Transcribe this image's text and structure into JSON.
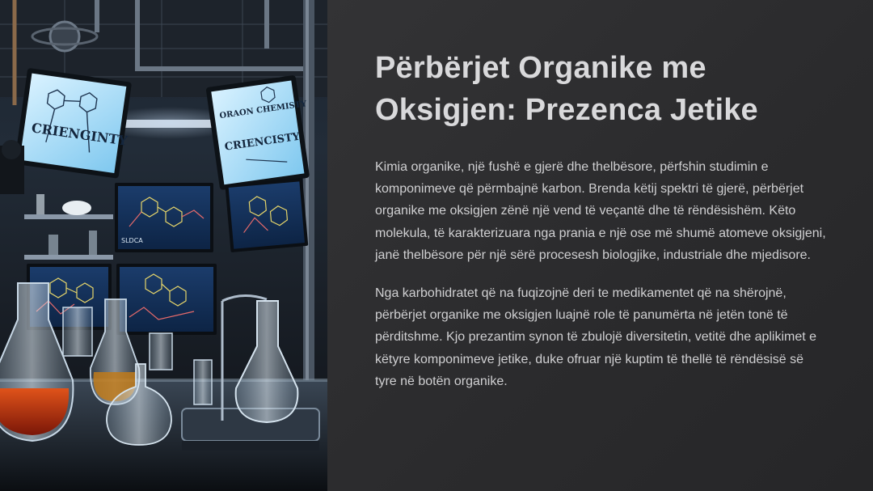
{
  "slide": {
    "title": "Përbërjet Organike me Oksigjen: Prezenca Jetike",
    "paragraphs": [
      "Kimia organike, një fushë e gjerë dhe thelbësore, përfshin studimin e komponimeve që përmbajnë karbon. Brenda këtij spektri të gjerë, përbërjet organike me oksigjen zënë një vend të veçantë dhe të rëndësishëm. Këto molekula, të karakterizuara nga prania e një ose më shumë atomeve oksigjeni, janë thelbësore për një sërë procesesh biologjike, industriale dhe mjedisore.",
      "Nga karbohidratet që na fuqizojnë deri te medikamentet që na shërojnë, përbërjet organike me oksigjen luajnë role të panumërta në jetën tonë të përditshme. Kjo prezantim synon të zbulojë diversitetin, vetitë dhe aplikimet e këtyre komponimeve jetike, duke ofruar një kuptim të thellë të rëndësisë së tyre në botën organike."
    ]
  },
  "image": {
    "monitor_texts": {
      "left_top": "CRIENGINTY",
      "right_top_heading": "ORAON CHEMISTY",
      "right_top_word": "CRIENCISTY",
      "mid_left_label": "SLDCA"
    }
  }
}
